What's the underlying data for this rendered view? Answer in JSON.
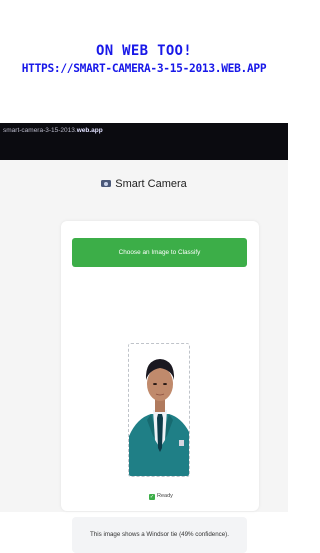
{
  "promo": {
    "line1": "ON WEB TOO!",
    "line2": "HTTPS://SMART-CAMERA-3-15-2013.WEB.APP"
  },
  "browser": {
    "url_prefix": "smart-camera-3-15-2013.",
    "url_domain": "web.app"
  },
  "app": {
    "title": "Smart Camera",
    "title_icon": "camera-icon",
    "choose_button_label": "Choose an Image to Classify",
    "status_label": "Ready",
    "status_icon": "check-icon",
    "result_text": "This image shows a Windsor tie (49% confidence)."
  },
  "colors": {
    "promo_text": "#1818e8",
    "button_green": "#3cae48",
    "browser_bar": "#0b0b10"
  }
}
